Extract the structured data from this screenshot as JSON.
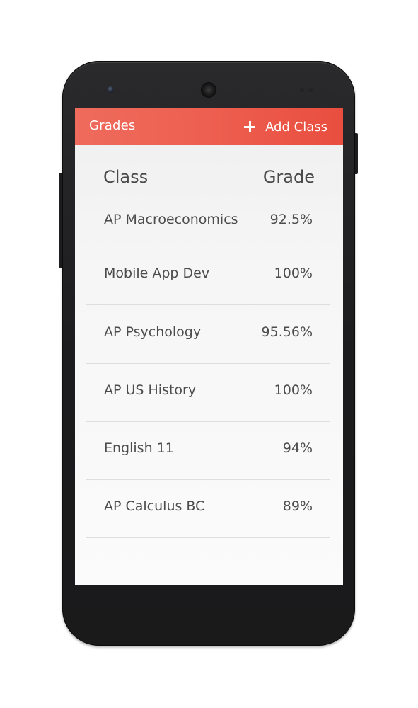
{
  "app": {
    "title": "Grades",
    "accent_color": "#ec5b4c"
  },
  "action_bar": {
    "title": "Grades",
    "add_button_label": "Add Class",
    "add_button_icon": "plus-icon"
  },
  "list": {
    "columns": {
      "class": "Class",
      "grade": "Grade"
    },
    "rows": [
      {
        "class": "AP Macroeconomics",
        "grade": "92.5%"
      },
      {
        "class": "Mobile App Dev",
        "grade": "100%"
      },
      {
        "class": "AP Psychology",
        "grade": "95.56%"
      },
      {
        "class": "AP US History",
        "grade": "100%"
      },
      {
        "class": "English 11",
        "grade": "94%"
      },
      {
        "class": "AP Calculus BC",
        "grade": "89%"
      }
    ]
  }
}
